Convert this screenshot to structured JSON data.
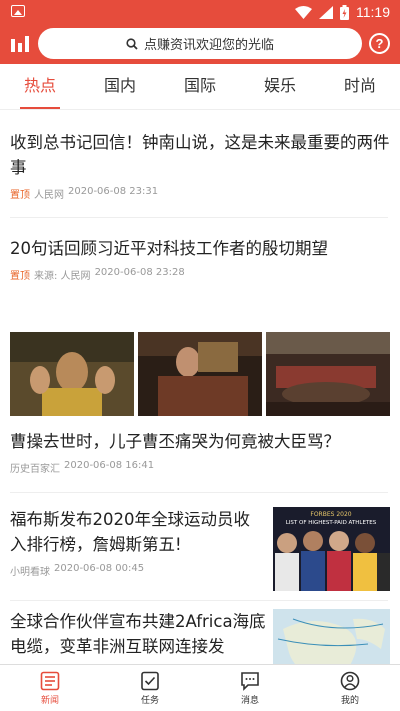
{
  "status_bar": {
    "time": "11:19"
  },
  "header": {
    "search_placeholder": "点赚资讯欢迎您的光临"
  },
  "tabs": [
    "热点",
    "国内",
    "国际",
    "娱乐",
    "时尚"
  ],
  "articles": [
    {
      "title": "收到总书记回信！钟南山说，这是未来最重要的两件事",
      "tag": "置顶",
      "source": "人民网",
      "time": "2020-06-08 23:31"
    },
    {
      "title": "20句话回顾习近平对科技工作者的殷切期望",
      "tag": "置顶",
      "source": "来源: 人民网",
      "time": "2020-06-08 23:28"
    },
    {
      "title": "曹操去世时，儿子曹丕痛哭为何竟被大臣骂？",
      "source": "历史百家汇",
      "time": "2020-06-08 16:41"
    },
    {
      "title": "福布斯发布2020年全球运动员收入排行榜，詹姆斯第五!",
      "source": "小明看球",
      "time": "2020-06-08 00:45",
      "thumb_text": [
        "FORBES 2020",
        "LIST OF HIGHEST-PAID ATHLETES"
      ]
    },
    {
      "title": "全球合作伙伴宣布共建2Africa海底电缆，变革非洲互联网连接发"
    }
  ],
  "bottom_nav": [
    {
      "label": "新闻",
      "icon": "news-icon"
    },
    {
      "label": "任务",
      "icon": "task-icon"
    },
    {
      "label": "消息",
      "icon": "message-icon"
    },
    {
      "label": "我的",
      "icon": "profile-icon"
    }
  ],
  "colors": {
    "brand": "#e64c3c",
    "tag": "#e8652a"
  }
}
